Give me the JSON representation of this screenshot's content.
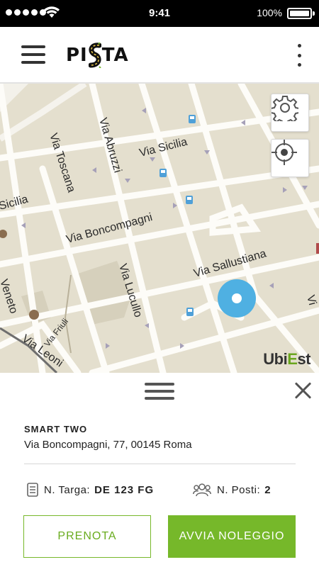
{
  "status_bar": {
    "time": "9:41",
    "battery": "100%"
  },
  "header": {
    "logo_left": "PI",
    "logo_right": "TA",
    "menu_icon": "hamburger-icon",
    "more_icon": "more-vertical-icon"
  },
  "map": {
    "streets": [
      "Via Sicilia",
      "Via Abruzzi",
      "Via Toscana",
      "Sicilia",
      "Via Boncompagni",
      "Via Sallustiana",
      "Via Lucullo",
      "Veneto",
      "Via Friuli",
      "Via Leoni"
    ],
    "watermark_left": "Ubi",
    "watermark_accent": "E",
    "watermark_right": "st",
    "settings_icon": "gear-icon",
    "locate_icon": "crosshair-icon"
  },
  "sheet": {
    "car_model": "SMART TWO",
    "address": "Via Boncompagni, 77, 00145 Roma",
    "plate_label": "N. Targa:",
    "plate_value": "DE 123 FG",
    "seats_label": "N. Posti:",
    "seats_value": "2",
    "book_label": "PRENOTA",
    "start_label": "AVVIA NOLEGGIO"
  },
  "colors": {
    "accent": "#76b82a",
    "pin": "#4fb0e2",
    "map_bg": "#e4dfce",
    "road": "#fdfcf8"
  }
}
